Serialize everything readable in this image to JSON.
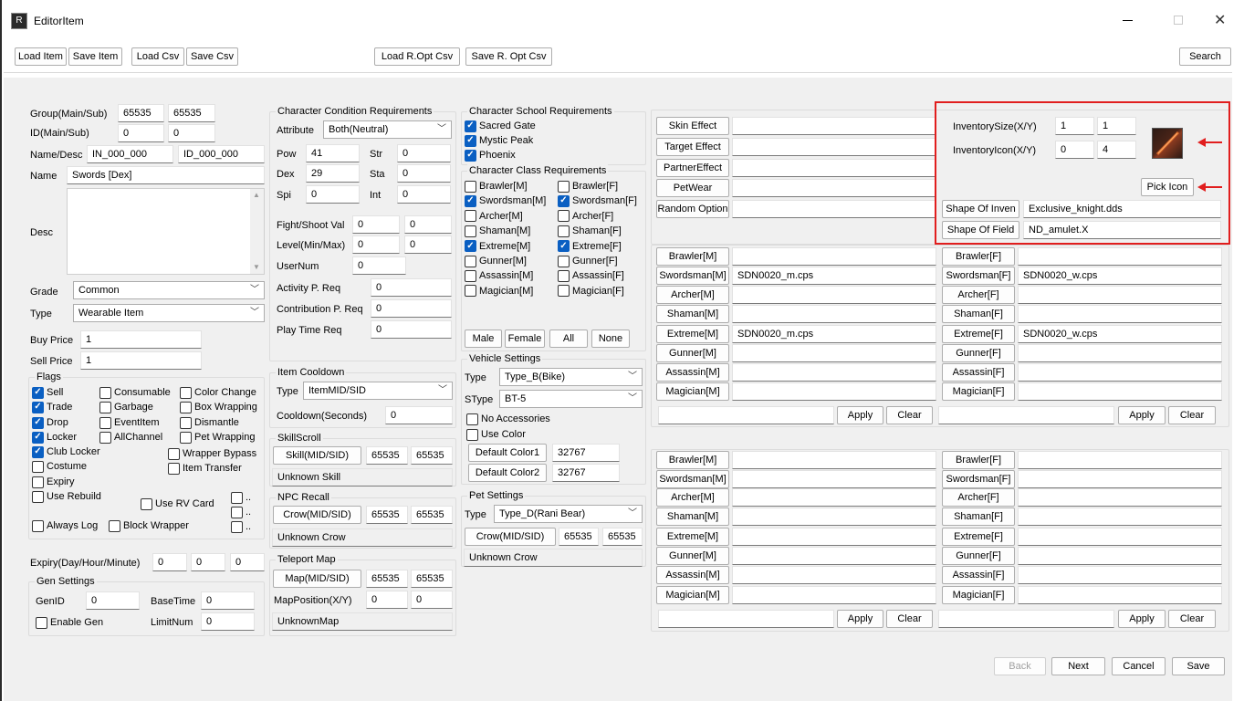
{
  "window": {
    "title": "EditorItem"
  },
  "toolbar": {
    "load_item": "Load Item",
    "save_item": "Save Item",
    "load_csv": "Load Csv",
    "save_csv": "Save Csv",
    "load_ropt": "Load R.Opt Csv",
    "save_ropt": "Save R. Opt Csv",
    "search": "Search"
  },
  "basic": {
    "group_label": "Group(Main/Sub)",
    "group_main": "65535",
    "group_sub": "65535",
    "id_label": "ID(Main/Sub)",
    "id_main": "0",
    "id_sub": "0",
    "namedesc_label": "Name/Desc",
    "name_code": "IN_000_000",
    "desc_code": "ID_000_000",
    "name_label": "Name",
    "name_value": "Swords [Dex]",
    "desc_label": "Desc",
    "grade_label": "Grade",
    "grade_value": "Common",
    "type_label": "Type",
    "type_value": "Wearable Item",
    "buy_label": "Buy Price",
    "buy_value": "1",
    "sell_label": "Sell Price",
    "sell_value": "1"
  },
  "flags": {
    "title": "Flags",
    "items": [
      {
        "label": "Sell",
        "checked": true
      },
      {
        "label": "Consumable",
        "checked": false
      },
      {
        "label": "Color Change",
        "checked": false
      },
      {
        "label": "Trade",
        "checked": true
      },
      {
        "label": "Garbage",
        "checked": false
      },
      {
        "label": "Box Wrapping",
        "checked": false
      },
      {
        "label": "Drop",
        "checked": true
      },
      {
        "label": "EventItem",
        "checked": false
      },
      {
        "label": "Dismantle",
        "checked": false
      },
      {
        "label": "Locker",
        "checked": true
      },
      {
        "label": "AllChannel",
        "checked": false
      },
      {
        "label": "Pet Wrapping",
        "checked": false
      },
      {
        "label": "Club Locker",
        "checked": true
      },
      {
        "label": "Wrapper Bypass",
        "checked": false
      },
      {
        "label": "Costume",
        "checked": false
      },
      {
        "label": "Item Transfer",
        "checked": false
      },
      {
        "label": "Expiry",
        "checked": false
      },
      {
        "label": "Use Rebuild",
        "checked": false
      },
      {
        "label": "Use RV Card",
        "checked": false
      },
      {
        "label": "Always Log",
        "checked": false
      },
      {
        "label": "Block Wrapper",
        "checked": false
      }
    ],
    "more": ".."
  },
  "expiry": {
    "label": "Expiry(Day/Hour/Minute)",
    "day": "0",
    "hour": "0",
    "minute": "0"
  },
  "gen": {
    "title": "Gen Settings",
    "genid_label": "GenID",
    "genid": "0",
    "basetime_label": "BaseTime",
    "basetime": "0",
    "enable_label": "Enable Gen",
    "limitnum_label": "LimitNum",
    "limitnum": "0"
  },
  "charcond": {
    "title": "Character Condition Requirements",
    "attribute_label": "Attribute",
    "attribute_value": "Both(Neutral)",
    "pow_label": "Pow",
    "pow": "41",
    "str_label": "Str",
    "str": "0",
    "dex_label": "Dex",
    "dex": "29",
    "sta_label": "Sta",
    "sta": "0",
    "spi_label": "Spi",
    "spi": "0",
    "int_label": "Int",
    "int": "0",
    "fight_label": "Fight/Shoot Val",
    "fight_a": "0",
    "fight_b": "0",
    "level_label": "Level(Min/Max)",
    "level_min": "0",
    "level_max": "0",
    "usernum_label": "UserNum",
    "usernum": "0",
    "activity_label": "Activity P. Req",
    "activity": "0",
    "contribution_label": "Contribution P. Req",
    "contribution": "0",
    "playtime_label": "Play Time Req",
    "playtime": "0"
  },
  "cooldown": {
    "title": "Item Cooldown",
    "type_label": "Type",
    "type_value": "ItemMID/SID",
    "seconds_label": "Cooldown(Seconds)",
    "seconds": "0"
  },
  "skillscroll": {
    "title": "SkillScroll",
    "btn": "Skill(MID/SID)",
    "mid": "65535",
    "sid": "65535",
    "name": "Unknown Skill"
  },
  "npcrecall": {
    "title": "NPC Recall",
    "btn": "Crow(MID/SID)",
    "mid": "65535",
    "sid": "65535",
    "name": "Unknown Crow"
  },
  "teleport": {
    "title": "Teleport Map",
    "btn": "Map(MID/SID)",
    "mid": "65535",
    "sid": "65535",
    "pos_label": "MapPosition(X/Y)",
    "x": "0",
    "y": "0",
    "name": "UnknownMap"
  },
  "school": {
    "title": "Character School Requirements",
    "items": [
      {
        "label": "Sacred Gate",
        "checked": true
      },
      {
        "label": "Mystic Peak",
        "checked": true
      },
      {
        "label": "Phoenix",
        "checked": true
      }
    ]
  },
  "classreq": {
    "title": "Character Class Requirements",
    "left": [
      {
        "label": "Brawler[M]",
        "checked": false
      },
      {
        "label": "Swordsman[M]",
        "checked": true
      },
      {
        "label": "Archer[M]",
        "checked": false
      },
      {
        "label": "Shaman[M]",
        "checked": false
      },
      {
        "label": "Extreme[M]",
        "checked": true
      },
      {
        "label": "Gunner[M]",
        "checked": false
      },
      {
        "label": "Assassin[M]",
        "checked": false
      },
      {
        "label": "Magician[M]",
        "checked": false
      }
    ],
    "right": [
      {
        "label": "Brawler[F]",
        "checked": false
      },
      {
        "label": "Swordsman[F]",
        "checked": true
      },
      {
        "label": "Archer[F]",
        "checked": false
      },
      {
        "label": "Shaman[F]",
        "checked": false
      },
      {
        "label": "Extreme[F]",
        "checked": true
      },
      {
        "label": "Gunner[F]",
        "checked": false
      },
      {
        "label": "Assassin[F]",
        "checked": false
      },
      {
        "label": "Magician[F]",
        "checked": false
      }
    ],
    "male": "Male",
    "female": "Female",
    "all": "All",
    "none": "None"
  },
  "vehicle": {
    "title": "Vehicle Settings",
    "type_label": "Type",
    "type_value": "Type_B(Bike)",
    "stype_label": "SType",
    "stype_value": "BT-5",
    "no_acc": "No Accessories",
    "use_color": "Use Color",
    "color1_btn": "Default Color1",
    "color1": "32767",
    "color2_btn": "Default Color2",
    "color2": "32767"
  },
  "pet": {
    "title": "Pet Settings",
    "type_label": "Type",
    "type_value": "Type_D(Rani Bear)",
    "btn": "Crow(MID/SID)",
    "mid": "65535",
    "sid": "65535",
    "name": "Unknown Crow"
  },
  "effects": {
    "skin": "Skin Effect",
    "target": "Target Effect",
    "partner": "PartnerEffect",
    "petwear": "PetWear",
    "random": "Random Option"
  },
  "inventory": {
    "size_label": "InventorySize(X/Y)",
    "size_x": "1",
    "size_y": "1",
    "icon_label": "InventoryIcon(X/Y)",
    "icon_x": "0",
    "icon_y": "4",
    "pick": "Pick Icon",
    "shape_inven_btn": "Shape Of Inven",
    "shape_inven": "Exclusive_knight.dds",
    "shape_field_btn": "Shape Of Field",
    "shape_field": "ND_amulet.X"
  },
  "wear1": {
    "male": [
      {
        "label": "Brawler[M]",
        "file": ""
      },
      {
        "label": "Swordsman[M]",
        "file": "SDN0020_m.cps"
      },
      {
        "label": "Archer[M]",
        "file": ""
      },
      {
        "label": "Shaman[M]",
        "file": ""
      },
      {
        "label": "Extreme[M]",
        "file": "SDN0020_m.cps"
      },
      {
        "label": "Gunner[M]",
        "file": ""
      },
      {
        "label": "Assassin[M]",
        "file": ""
      },
      {
        "label": "Magician[M]",
        "file": ""
      }
    ],
    "female": [
      {
        "label": "Brawler[F]",
        "file": ""
      },
      {
        "label": "Swordsman[F]",
        "file": "SDN0020_w.cps"
      },
      {
        "label": "Archer[F]",
        "file": ""
      },
      {
        "label": "Shaman[F]",
        "file": ""
      },
      {
        "label": "Extreme[F]",
        "file": "SDN0020_w.cps"
      },
      {
        "label": "Gunner[F]",
        "file": ""
      },
      {
        "label": "Assassin[F]",
        "file": ""
      },
      {
        "label": "Magician[F]",
        "file": ""
      }
    ]
  },
  "wear2": {
    "male": [
      "Brawler[M]",
      "Swordsman[M]",
      "Archer[M]",
      "Shaman[M]",
      "Extreme[M]",
      "Gunner[M]",
      "Assassin[M]",
      "Magician[M]"
    ],
    "female": [
      "Brawler[F]",
      "Swordsman[F]",
      "Archer[F]",
      "Shaman[F]",
      "Extreme[F]",
      "Gunner[F]",
      "Assassin[F]",
      "Magician[F]"
    ]
  },
  "apply": "Apply",
  "clear": "Clear",
  "footer": {
    "back": "Back",
    "next": "Next",
    "cancel": "Cancel",
    "save": "Save"
  },
  "colors": {
    "accent": "#0a5fc2",
    "highlight": "#e11e1e"
  }
}
